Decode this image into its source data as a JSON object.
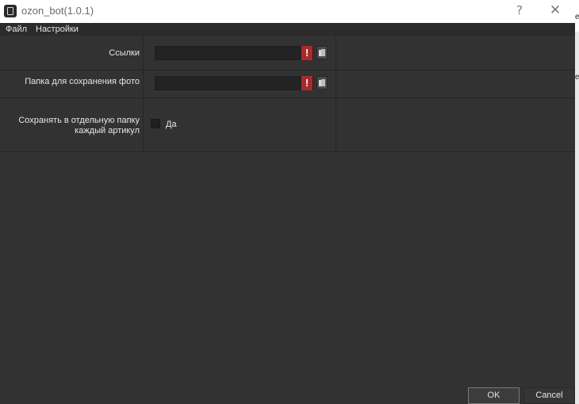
{
  "window": {
    "title": "ozon_bot(1.0.1)",
    "help_glyph": "?",
    "close_glyph": "✕"
  },
  "menu": {
    "items": [
      {
        "label": "Файл"
      },
      {
        "label": "Настройки"
      }
    ]
  },
  "form": {
    "links": {
      "label": "Ссылки",
      "value": "",
      "warning_glyph": "!"
    },
    "photo_folder": {
      "label": "Папка для сохранения фото",
      "value": "",
      "warning_glyph": "!"
    },
    "separate_folder": {
      "label_line1": "Сохранять в отдельную папку",
      "label_line2": "каждый артикул",
      "checkbox_label": "Да",
      "checked": false
    }
  },
  "buttons": {
    "ok": "OK",
    "cancel": "Cancel"
  },
  "background_window": {
    "glyph1": "е",
    "glyph2": "е"
  },
  "colors": {
    "background": "#323232",
    "warning": "#a92a2a",
    "text": "#e6e6e6"
  }
}
